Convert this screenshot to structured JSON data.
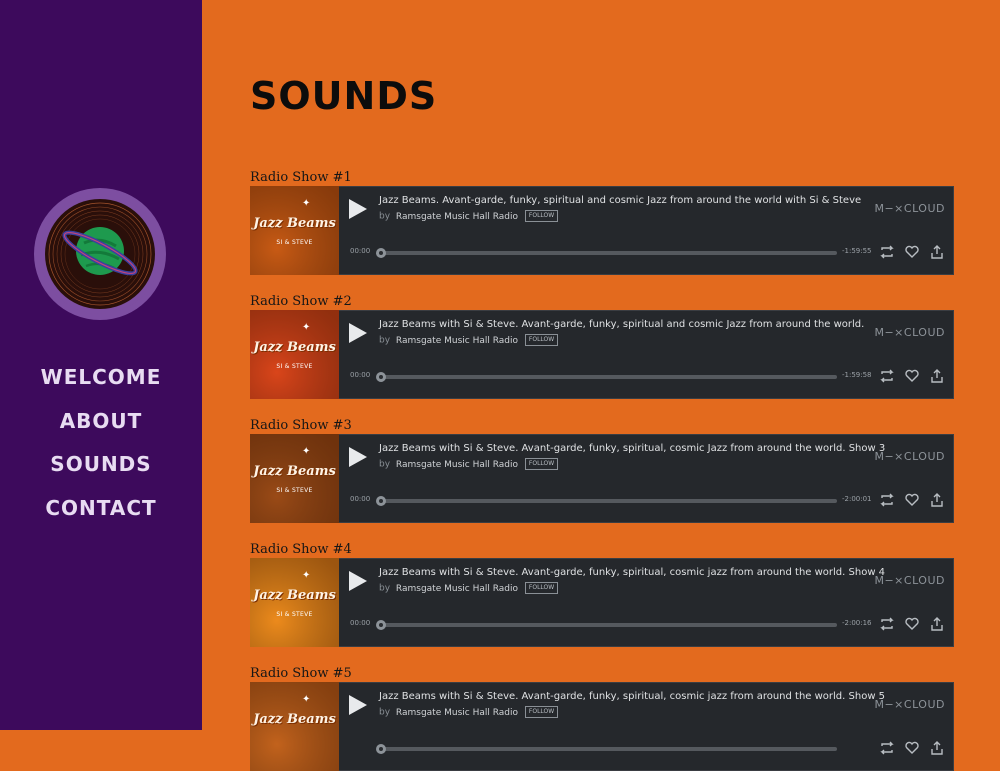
{
  "nav": [
    "WELCOME",
    "ABOUT",
    "SOUNDS",
    "CONTACT"
  ],
  "page_title": "SOUNDS",
  "colors": {
    "sidebar": "#3d0a5c",
    "background": "#e36a1e",
    "player_bg": "#25282c"
  },
  "shows": [
    {
      "label": "Radio Show #1",
      "title": "Jazz Beams. Avant-garde, funky, spiritual and cosmic Jazz from around the world with Si & Steve",
      "by": "by",
      "uploader": "Ramsgate Music Hall Radio",
      "follow": "FOLLOW",
      "brand": "M−×CLOUD",
      "time_start": "00:00",
      "time_end": "-1:59:55",
      "art_title": "Jazz Beams",
      "art_sub": "SI & STEVE",
      "art_color": "#c85a14"
    },
    {
      "label": "Radio Show #2",
      "title": "Jazz Beams with Si & Steve. Avant-garde, funky, spiritual and cosmic Jazz from around the world.",
      "by": "by",
      "uploader": "Ramsgate Music Hall Radio",
      "follow": "FOLLOW",
      "brand": "M−×CLOUD",
      "time_start": "00:00",
      "time_end": "-1:59:58",
      "art_title": "Jazz Beams",
      "art_sub": "SI & STEVE",
      "art_color": "#d9451a"
    },
    {
      "label": "Radio Show #3",
      "title": "Jazz Beams with Si & Steve. Avant-garde, funky, spiritual, cosmic Jazz from around the world. Show 3",
      "by": "by",
      "uploader": "Ramsgate Music Hall Radio",
      "follow": "FOLLOW",
      "brand": "M−×CLOUD",
      "time_start": "00:00",
      "time_end": "-2:00:01",
      "art_title": "Jazz Beams",
      "art_sub": "SI & STEVE",
      "art_color": "#9a4a16"
    },
    {
      "label": "Radio Show #4",
      "title": "Jazz Beams with Si & Steve. Avant-garde, funky, spiritual, cosmic jazz from around the world. Show 4",
      "by": "by",
      "uploader": "Ramsgate Music Hall Radio",
      "follow": "FOLLOW",
      "brand": "M−×CLOUD",
      "time_start": "00:00",
      "time_end": "-2:00:16",
      "art_title": "Jazz Beams",
      "art_sub": "SI & STEVE",
      "art_color": "#ec8a1c"
    },
    {
      "label": "Radio Show #5",
      "title": "Jazz Beams with Si & Steve. Avant-garde, funky, spiritual, cosmic jazz from around the world. Show 5",
      "by": "by",
      "uploader": "Ramsgate Music Hall Radio",
      "follow": "FOLLOW",
      "brand": "M−×CLOUD",
      "time_start": "",
      "time_end": "",
      "art_title": "Jazz Beams",
      "art_sub": "",
      "art_color": "#c2621c"
    }
  ]
}
